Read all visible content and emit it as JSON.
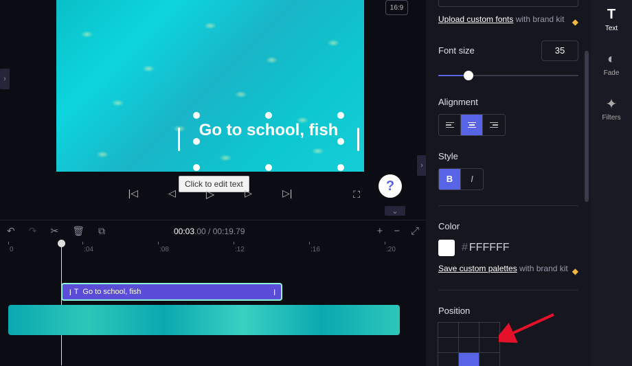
{
  "preview": {
    "text_overlay": "Go to school, fish",
    "tooltip": "Click to edit text",
    "aspect_ratio": "16:9"
  },
  "timeline": {
    "current_time": "00:03",
    "current_frames": ".00",
    "duration_time": "00:19",
    "duration_frames": ".79",
    "ticks": [
      "0",
      ":04",
      ":08",
      ":12",
      ":16",
      ":20"
    ],
    "text_clip_label": "Go to school, fish"
  },
  "panel": {
    "upload_fonts_link": "Upload custom fonts",
    "upload_fonts_suffix": " with brand kit",
    "font_size_label": "Font size",
    "font_size_value": "35",
    "alignment_label": "Alignment",
    "style_label": "Style",
    "bold": "B",
    "italic": "I",
    "color_label": "Color",
    "color_hex": "FFFFFF",
    "save_palettes_link": "Save custom palettes",
    "save_palettes_suffix": " with brand kit",
    "position_label": "Position"
  },
  "tabs": {
    "text": "Text",
    "fade": "Fade",
    "filters": "Filters"
  }
}
